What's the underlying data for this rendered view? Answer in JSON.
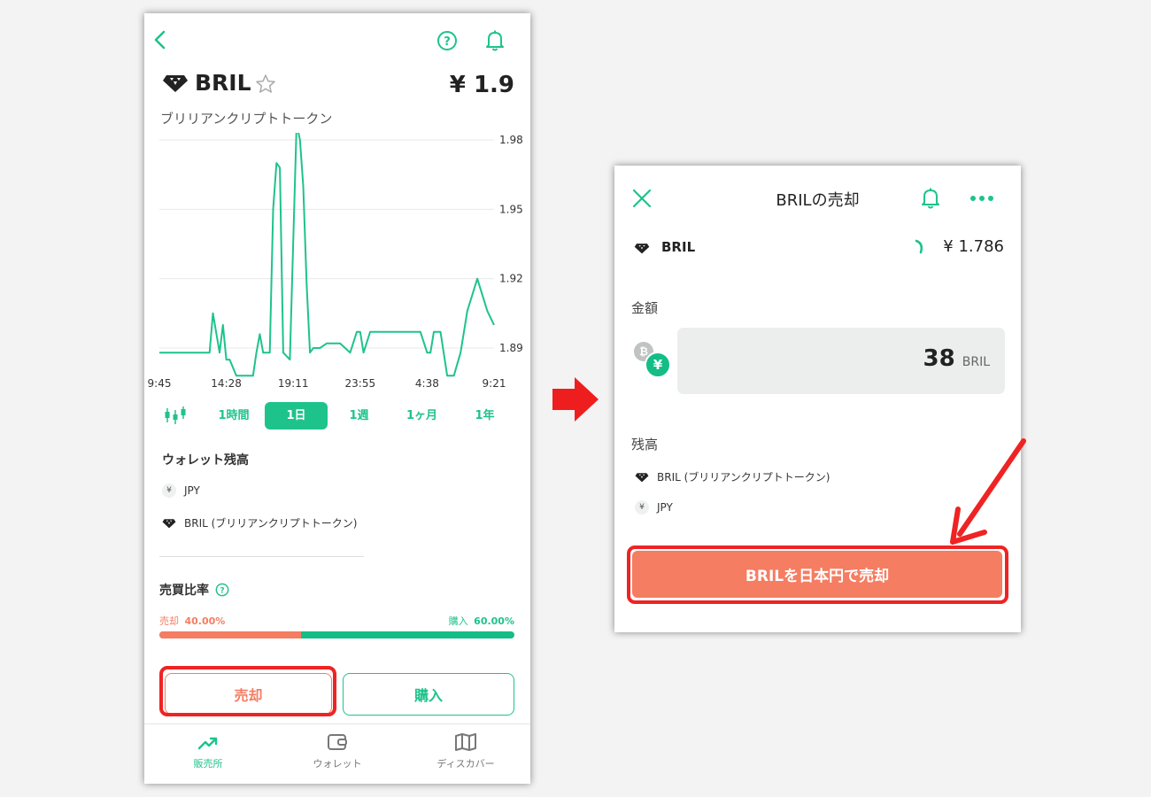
{
  "colors": {
    "accent": "#1ec38b",
    "sell": "#f57d62",
    "highlight": "#ef2323"
  },
  "left": {
    "coin": {
      "symbol": "BRIL",
      "full_name": "ブリリアンクリプトトークン",
      "price": "¥ 1.9"
    },
    "chart_data": {
      "type": "line",
      "x_ticks": [
        "9:45",
        "14:28",
        "19:11",
        "23:55",
        "4:38",
        "9:21"
      ],
      "y_ticks": [
        "1.98",
        "1.95",
        "1.92",
        "1.89"
      ],
      "ylim": [
        1.89,
        1.98
      ],
      "grid": true,
      "x": [
        0,
        3,
        5,
        6,
        8,
        10,
        13,
        14,
        15,
        16,
        18,
        19,
        20,
        21,
        23,
        24,
        25,
        27,
        28,
        29,
        30,
        31,
        32,
        33,
        34,
        35,
        36,
        37,
        39,
        41,
        42,
        43,
        44,
        45,
        46,
        47,
        48,
        50,
        54,
        57,
        59,
        60,
        61,
        63,
        65,
        68,
        70,
        72,
        74,
        76,
        78,
        80,
        81,
        82,
        84,
        86,
        88,
        90,
        92,
        95,
        98,
        100
      ],
      "values": [
        1.888,
        1.888,
        1.888,
        1.888,
        1.888,
        1.888,
        1.888,
        1.888,
        1.888,
        1.905,
        1.888,
        1.9,
        1.885,
        1.885,
        1.878,
        1.878,
        1.878,
        1.878,
        1.878,
        1.888,
        1.896,
        1.888,
        1.888,
        1.888,
        1.95,
        1.97,
        1.968,
        1.888,
        1.885,
        1.987,
        1.98,
        1.96,
        1.918,
        1.888,
        1.89,
        1.89,
        1.89,
        1.892,
        1.892,
        1.888,
        1.897,
        1.897,
        1.888,
        1.897,
        1.897,
        1.897,
        1.897,
        1.897,
        1.897,
        1.897,
        1.897,
        1.888,
        1.888,
        1.897,
        1.897,
        1.878,
        1.878,
        1.888,
        1.906,
        1.92,
        1.906,
        1.9
      ]
    },
    "ranges": {
      "candle_icon": "candlestick-icon",
      "items": [
        "1時間",
        "1日",
        "1週",
        "1ヶ月",
        "1年"
      ],
      "active": "1日"
    },
    "wallet": {
      "title": "ウォレット残高",
      "jpy_label": "JPY",
      "jpy_symbol": "¥",
      "bril_label": "BRIL (ブリリアンクリプトトークン)"
    },
    "ratio": {
      "title": "売買比率",
      "sell_label": "売却",
      "sell_pct": "40.00%",
      "buy_label": "購入",
      "buy_pct": "60.00%",
      "sell_fraction": 0.4
    },
    "buttons": {
      "sell": "売却",
      "buy": "購入"
    },
    "nav": {
      "items": [
        "販売所",
        "ウォレット",
        "ディスカバー"
      ],
      "active": "販売所"
    }
  },
  "right": {
    "header": {
      "title": "BRILの売却"
    },
    "coin": {
      "symbol": "BRIL",
      "price": "¥ 1.786"
    },
    "amount": {
      "label": "金額",
      "value": "38",
      "unit": "BRIL",
      "jpy_symbol": "¥",
      "btc_symbol": "₿"
    },
    "balance": {
      "label": "残高",
      "bril_label": "BRIL (ブリリアンクリプトトークン)",
      "jpy_label": "JPY",
      "jpy_symbol": "¥"
    },
    "sell_button": "BRILを日本円で売却"
  }
}
